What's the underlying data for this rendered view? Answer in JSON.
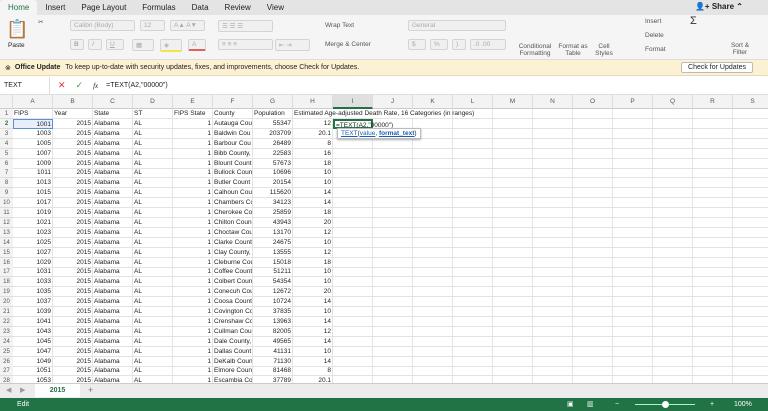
{
  "ribbon_tabs": [
    "Home",
    "Insert",
    "Page Layout",
    "Formulas",
    "Data",
    "Review",
    "View"
  ],
  "share": "Share",
  "ribbon": {
    "paste": "Paste",
    "font": "Calibri (Body)",
    "size": "12",
    "wrap_text": "Wrap Text",
    "merge_center": "Merge & Center",
    "number_format": "General",
    "conditional": "Conditional Formatting",
    "format_table": "Format as Table",
    "cell_styles": "Cell Styles",
    "insert": "Insert",
    "delete": "Delete",
    "format": "Format",
    "sort_filter": "Sort & Filter",
    "bold": "B",
    "italic": "I",
    "underline": "U",
    "currency": "$",
    "percent": "%",
    "comma": ")",
    "sum": "Σ"
  },
  "update": {
    "title": "Office Update",
    "message": "To keep up-to-date with security updates, fixes, and improvements, choose Check for Updates.",
    "button": "Check for Updates"
  },
  "formula": {
    "name_box": "TEXT",
    "fx": "fx",
    "cancel": "✕",
    "enter": "✓",
    "value": "=TEXT(A2,\"00000\")"
  },
  "columns": [
    "A",
    "B",
    "C",
    "D",
    "E",
    "F",
    "G",
    "H",
    "I",
    "J",
    "K",
    "L",
    "M",
    "N",
    "O",
    "P",
    "Q",
    "R",
    "S"
  ],
  "headers": [
    "FIPS",
    "Year",
    "State",
    "ST",
    "FIPS State",
    "County",
    "Population",
    "Estimated Age-adjusted Death Rate, 16 Categories (in ranges)"
  ],
  "rows": [
    [
      "1001",
      "2015",
      "Alabama",
      "AL",
      "1",
      "Autauga Cou",
      "55347",
      "12"
    ],
    [
      "1003",
      "2015",
      "Alabama",
      "AL",
      "1",
      "Baldwin Cou",
      "203709",
      "20.1"
    ],
    [
      "1005",
      "2015",
      "Alabama",
      "AL",
      "1",
      "Barbour Cou",
      "26489",
      "8"
    ],
    [
      "1007",
      "2015",
      "Alabama",
      "AL",
      "1",
      "Bibb County,",
      "22583",
      "16"
    ],
    [
      "1009",
      "2015",
      "Alabama",
      "AL",
      "1",
      "Blount Count",
      "57673",
      "18"
    ],
    [
      "1011",
      "2015",
      "Alabama",
      "AL",
      "1",
      "Bullock Coun",
      "10696",
      "10"
    ],
    [
      "1013",
      "2015",
      "Alabama",
      "AL",
      "1",
      "Butler Count",
      "20154",
      "10"
    ],
    [
      "1015",
      "2015",
      "Alabama",
      "AL",
      "1",
      "Calhoun Cou",
      "115620",
      "14"
    ],
    [
      "1017",
      "2015",
      "Alabama",
      "AL",
      "1",
      "Chambers Co",
      "34123",
      "14"
    ],
    [
      "1019",
      "2015",
      "Alabama",
      "AL",
      "1",
      "Cherokee Co",
      "25859",
      "18"
    ],
    [
      "1021",
      "2015",
      "Alabama",
      "AL",
      "1",
      "Chilton Coun",
      "43943",
      "20"
    ],
    [
      "1023",
      "2015",
      "Alabama",
      "AL",
      "1",
      "Choctaw Cou",
      "13170",
      "12"
    ],
    [
      "1025",
      "2015",
      "Alabama",
      "AL",
      "1",
      "Clarke Count",
      "24675",
      "10"
    ],
    [
      "1027",
      "2015",
      "Alabama",
      "AL",
      "1",
      "Clay County,",
      "13555",
      "12"
    ],
    [
      "1029",
      "2015",
      "Alabama",
      "AL",
      "1",
      "Cleburne Cou",
      "15018",
      "18"
    ],
    [
      "1031",
      "2015",
      "Alabama",
      "AL",
      "1",
      "Coffee Count",
      "51211",
      "10"
    ],
    [
      "1033",
      "2015",
      "Alabama",
      "AL",
      "1",
      "Colbert Coun",
      "54354",
      "10"
    ],
    [
      "1035",
      "2015",
      "Alabama",
      "AL",
      "1",
      "Conecuh Cou",
      "12672",
      "20"
    ],
    [
      "1037",
      "2015",
      "Alabama",
      "AL",
      "1",
      "Coosa Count",
      "10724",
      "14"
    ],
    [
      "1039",
      "2015",
      "Alabama",
      "AL",
      "1",
      "Covington Co",
      "37835",
      "10"
    ],
    [
      "1041",
      "2015",
      "Alabama",
      "AL",
      "1",
      "Crenshaw Co",
      "13963",
      "14"
    ],
    [
      "1043",
      "2015",
      "Alabama",
      "AL",
      "1",
      "Cullman Cou",
      "82005",
      "12"
    ],
    [
      "1045",
      "2015",
      "Alabama",
      "AL",
      "1",
      "Dale County,",
      "49565",
      "14"
    ],
    [
      "1047",
      "2015",
      "Alabama",
      "AL",
      "1",
      "Dallas Count",
      "41131",
      "10"
    ],
    [
      "1049",
      "2015",
      "Alabama",
      "AL",
      "1",
      "DeKalb Coun",
      "71130",
      "14"
    ],
    [
      "1051",
      "2015",
      "Alabama",
      "AL",
      "1",
      "Elmore Coun",
      "81468",
      "8"
    ],
    [
      "1053",
      "2015",
      "Alabama",
      "AL",
      "1",
      "Escambia Co",
      "37789",
      "20.1"
    ]
  ],
  "active_cell": {
    "ref": "I2",
    "text": "=TEXT(A2,\"00000\")"
  },
  "tooltip": {
    "fn": "TEXT",
    "arg1": "value",
    "arg2": "format_text"
  },
  "sheet": {
    "name": "2015",
    "add": "+"
  },
  "status": {
    "mode": "Edit",
    "zoom": "100%"
  },
  "colors": {
    "accent": "#217346"
  }
}
